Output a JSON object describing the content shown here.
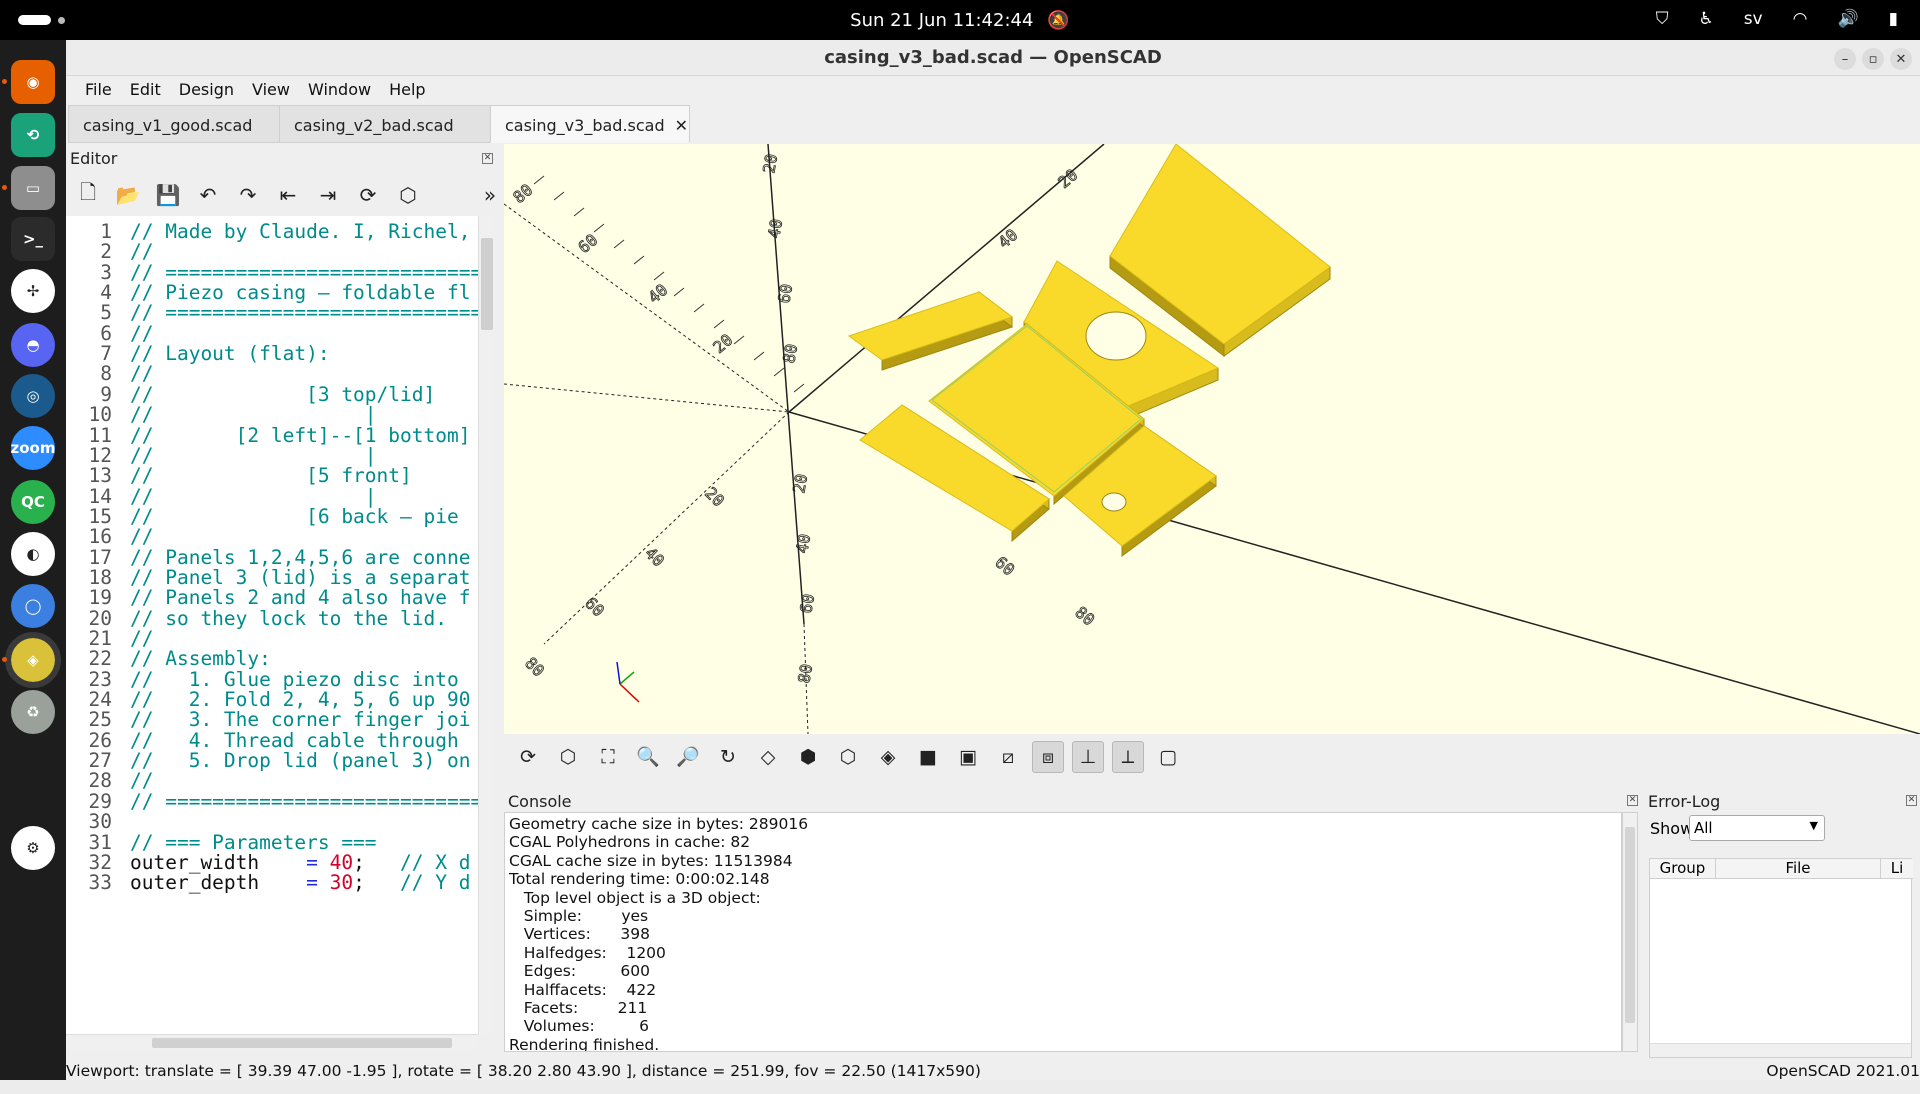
{
  "topbar": {
    "clock": "Sun 21 Jun  11:42:44",
    "lang": "sv"
  },
  "dock": {
    "apps": [
      {
        "name": "firefox",
        "color": "#e66000",
        "glyph": "◉"
      },
      {
        "name": "app-green",
        "color": "#1aa37a",
        "glyph": "⟲"
      },
      {
        "name": "files",
        "color": "#8e8e8e",
        "glyph": "▭"
      },
      {
        "name": "terminal",
        "color": "#2b2b2b",
        "glyph": ">_"
      },
      {
        "name": "slack",
        "color": "#ffffff",
        "glyph": "✢"
      },
      {
        "name": "discord",
        "color": "#5865f2",
        "glyph": "◓"
      },
      {
        "name": "steam",
        "color": "#1b5a8c",
        "glyph": "◎"
      },
      {
        "name": "zoom",
        "color": "#2d8cff",
        "glyph": "zoom"
      },
      {
        "name": "qc",
        "color": "#28b14c",
        "glyph": "QC"
      },
      {
        "name": "app-dark",
        "color": "#ffffff",
        "glyph": "◐"
      },
      {
        "name": "chromium",
        "color": "#3b7fe0",
        "glyph": "◯"
      },
      {
        "name": "openscad",
        "color": "#d9c23a",
        "glyph": "◈"
      },
      {
        "name": "trash",
        "color": "#9aa09a",
        "glyph": "♻"
      },
      {
        "name": "show-apps",
        "color": "#ffffff",
        "glyph": "⚙"
      }
    ]
  },
  "window": {
    "title": "casing_v3_bad.scad — OpenSCAD",
    "menu": [
      "File",
      "Edit",
      "Design",
      "View",
      "Window",
      "Help"
    ],
    "tabs": [
      "casing_v1_good.scad",
      "casing_v2_bad.scad",
      "casing_v3_bad.scad"
    ],
    "editor": {
      "title": "Editor",
      "lines": [
        {
          "n": "1",
          "t": "// Made by Claude. I, Richel,"
        },
        {
          "n": "2",
          "t": "//"
        },
        {
          "n": "3",
          "t": "// ================================"
        },
        {
          "n": "4",
          "t": "// Piezo casing — foldable fl"
        },
        {
          "n": "5",
          "t": "// ================================"
        },
        {
          "n": "6",
          "t": "//"
        },
        {
          "n": "7",
          "t": "// Layout (flat):"
        },
        {
          "n": "8",
          "t": "//"
        },
        {
          "n": "9",
          "t": "//             [3 top/lid]"
        },
        {
          "n": "10",
          "t": "//                  |"
        },
        {
          "n": "11",
          "t": "//       [2 left]--[1 bottom]"
        },
        {
          "n": "12",
          "t": "//                  |"
        },
        {
          "n": "13",
          "t": "//             [5 front]"
        },
        {
          "n": "14",
          "t": "//                  |"
        },
        {
          "n": "15",
          "t": "//             [6 back — pie"
        },
        {
          "n": "16",
          "t": "//"
        },
        {
          "n": "17",
          "t": "// Panels 1,2,4,5,6 are conne"
        },
        {
          "n": "18",
          "t": "// Panel 3 (lid) is a separat"
        },
        {
          "n": "19",
          "t": "// Panels 2 and 4 also have f"
        },
        {
          "n": "20",
          "t": "// so they lock to the lid."
        },
        {
          "n": "21",
          "t": "//"
        },
        {
          "n": "22",
          "t": "// Assembly:"
        },
        {
          "n": "23",
          "t": "//   1. Glue piezo disc into"
        },
        {
          "n": "24",
          "t": "//   2. Fold 2, 4, 5, 6 up 90"
        },
        {
          "n": "25",
          "t": "//   3. The corner finger joi"
        },
        {
          "n": "26",
          "t": "//   4. Thread cable through"
        },
        {
          "n": "27",
          "t": "//   5. Drop lid (panel 3) on"
        },
        {
          "n": "28",
          "t": "//"
        },
        {
          "n": "29",
          "t": "// ================================"
        },
        {
          "n": "30",
          "t": ""
        },
        {
          "n": "31",
          "t": "// === Parameters ==="
        }
      ],
      "code_lines": [
        {
          "n": "32",
          "name": "outer_width",
          "eq": "=",
          "val": "40;",
          "cm": "// X d"
        },
        {
          "n": "33",
          "name": "outer_depth",
          "eq": "=",
          "val": "30;",
          "cm": "// Y d"
        }
      ]
    },
    "viewport_labels": [
      "80",
      "60",
      "40",
      "20",
      "20",
      "40",
      "60",
      "80",
      "20",
      "40",
      "60",
      "80",
      "20",
      "40",
      "60",
      "80",
      "20",
      "40",
      "60",
      "80"
    ],
    "console": {
      "title": "Console",
      "lines": [
        "Geometry cache size in bytes: 289016",
        "CGAL Polyhedrons in cache: 82",
        "CGAL cache size in bytes: 11513984",
        "Total rendering time: 0:00:02.148",
        "   Top level object is a 3D object:",
        "   Simple:        yes",
        "   Vertices:      398",
        "   Halfedges:    1200",
        "   Edges:         600",
        "   Halffacets:    422",
        "   Facets:        211",
        "   Volumes:         6",
        "Rendering finished."
      ]
    },
    "errorlog": {
      "title": "Error-Log",
      "show_label": "Show",
      "show_value": "All",
      "cols": [
        "Group",
        "File",
        "Li"
      ]
    },
    "status": {
      "left": "Viewport: translate = [ 39.39 47.00 -1.95 ], rotate = [ 38.20 2.80 43.90 ], distance = 251.99, fov = 22.50 (1417x590)",
      "right": "OpenSCAD 2021.01"
    },
    "colors": {
      "viewport_bg": "#ffffe5",
      "panel": "#f9d92a",
      "panel_edge": "#b59b12",
      "highlight": "#8fd16a"
    }
  }
}
